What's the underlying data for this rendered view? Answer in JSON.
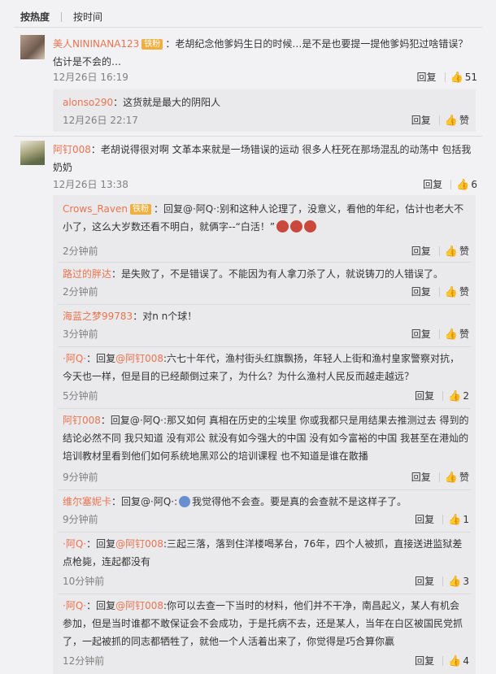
{
  "sort": {
    "by_heat": "按热度",
    "by_time": "按时间"
  },
  "comments": [
    {
      "user": "美人NININANA123",
      "badge": "铁粉",
      "text_line1": "：老胡纪念他爹妈生日的时候…是不是也要提一提他爹妈犯过啥错误？",
      "text_line2": "估计是不会的…",
      "time": "12月26日 16:19",
      "reply_label": "回复",
      "likes": "51",
      "replies": [
        {
          "user": "alonso290",
          "text": "：这货就是最大的阴阳人",
          "time": "12月26日 22:17",
          "reply_label": "回复",
          "likes": "赞"
        }
      ]
    },
    {
      "user": "阿钉008",
      "text_line1": "：老胡说得很对啊 文革本来就是一场错误的运动 很多人枉死在那场混乱的动荡中 包括我",
      "text_line2": "奶奶",
      "time": "12月26日 13:38",
      "reply_label": "回复",
      "likes": "6",
      "replies": [
        {
          "user": "Crows_Raven",
          "badge": "铁粉",
          "text": "：回复@·阿Q·:别和这种人论理了，没意义，看他的年纪，估计也老大不小了，这么大岁数还看不明白，就俩字--“白活！”",
          "time": "2分钟前",
          "reply_label": "回复",
          "likes": "赞"
        },
        {
          "user": "路过的胖达",
          "text": "：是失败了，不是错误了。不能因为有人拿刀杀了人，就说铸刀的人错误了。",
          "time": "2分钟前",
          "reply_label": "回复",
          "likes": "赞"
        },
        {
          "user": "海蓝之梦99783",
          "text": "：对n n个球！",
          "time": "3分钟前",
          "reply_label": "回复",
          "likes": "赞"
        },
        {
          "user": "·阿Q·",
          "prefix": "：回复",
          "mention": "@阿钉008",
          "text": ":六七十年代，渔村街头红旗飘扬，年轻人上街和渔村皇家警察对抗，今天也一样，但是目的已经颠倒过来了，为什么？为什么渔村人民反而越走越远？",
          "time": "5分钟前",
          "reply_label": "回复",
          "likes": "2"
        },
        {
          "user": "阿钉008",
          "text": "：回复@·阿Q·:那又如何 真相在历史的尘埃里 你或我都只是用结果去推测过去 得到的结论必然不同 我只知道 没有邓公 就没有如今强大的中国 没有如今富裕的中国 我甚至在港灿的培训教材里看到他们如何系统地黑邓公的培训课程 也不知道是谁在散播",
          "time": "9分钟前",
          "reply_label": "回复",
          "likes": "赞"
        },
        {
          "user": "维尔塞妮卡",
          "text_a": "：回复@·阿Q·:",
          "text": "我觉得他不会查。要是真的会查就不是这样子了。",
          "time": "9分钟前",
          "reply_label": "回复",
          "likes": "1"
        },
        {
          "user": "·阿Q·",
          "prefix": "：回复",
          "mention": "@阿钉008",
          "text": ":三起三落，落到住洋楼喝茅台，76年，四个人被抓，直接送进监狱差点枪毙，连起都没有",
          "time": "10分钟前",
          "reply_label": "回复",
          "likes": "3"
        },
        {
          "user": "·阿Q·",
          "prefix": "：回复",
          "mention": "@阿钉008",
          "text": ":你可以去查一下当时的材料，他们并不干净，南昌起义，某人有机会参加，但是当时谁都不敢保证会不会成功，于是托病不去，还是某人，当年在白区被国民党抓了，一起被抓的同志都牺牲了，就他一个人活着出来了，你觉得是巧合算你赢",
          "time": "12分钟前",
          "reply_label": "回复",
          "likes": "4"
        }
      ]
    }
  ]
}
